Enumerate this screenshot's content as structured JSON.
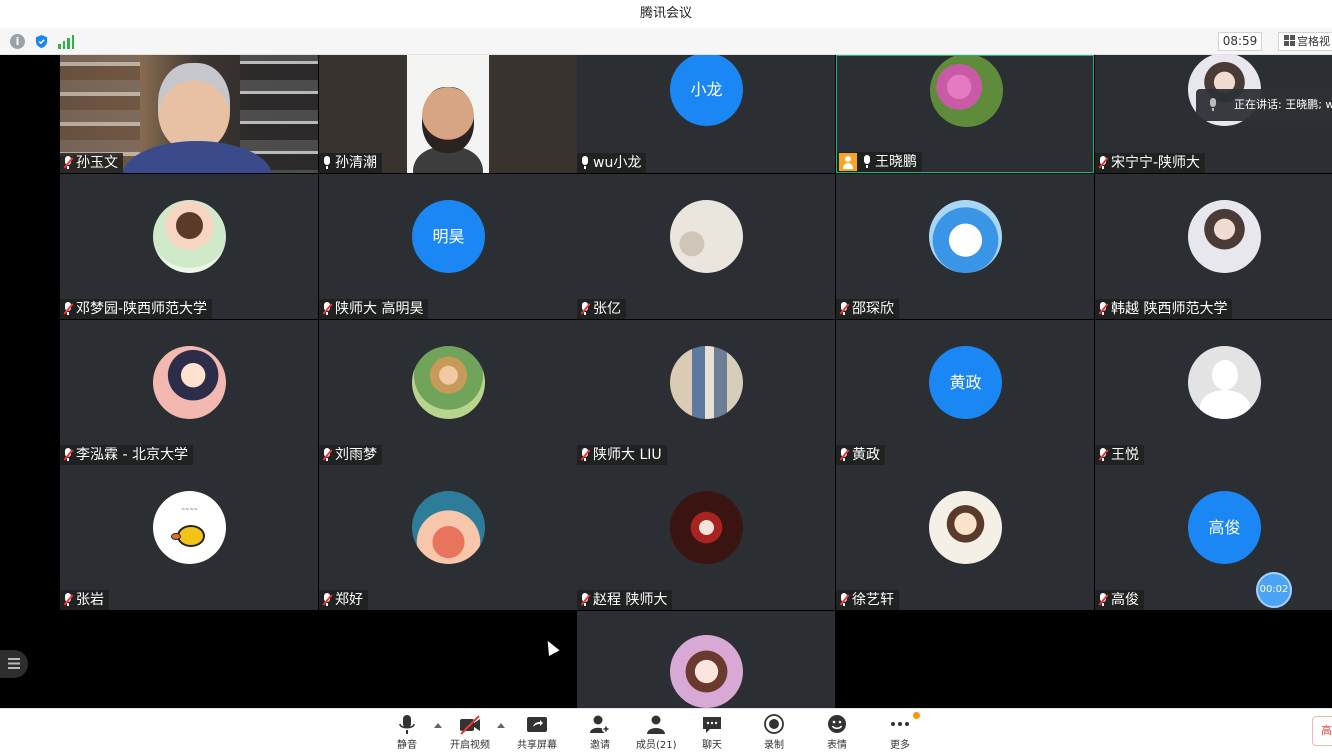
{
  "window": {
    "title": "腾讯会议"
  },
  "status": {
    "time": "08:59",
    "view_label": "宫格视",
    "info_icon": "info-icon",
    "security_icon": "shield-icon",
    "network_icon": "signal-icon"
  },
  "speaking": {
    "text": "正在讲话: 王晓鹏; w"
  },
  "timer": {
    "text": "00:02"
  },
  "participants": [
    {
      "name": "孙玉文",
      "muted": true,
      "kind": "video1"
    },
    {
      "name": "孙清潮",
      "muted": false,
      "kind": "video2"
    },
    {
      "name": "wu小龙",
      "muted": false,
      "kind": "text",
      "avatar_text": "小龙"
    },
    {
      "name": "王晓鹏",
      "muted": false,
      "kind": "pic",
      "pic": "av-flower",
      "host": true,
      "active": true
    },
    {
      "name": "宋宁宁-陕师大",
      "muted": true,
      "kind": "pic",
      "pic": "av-girl"
    },
    {
      "name": "邓梦园-陕西师范大学",
      "muted": true,
      "kind": "pic",
      "pic": "av-anime1"
    },
    {
      "name": "陕师大 高明昊",
      "muted": true,
      "kind": "text",
      "avatar_text": "明昊"
    },
    {
      "name": "张亿",
      "muted": true,
      "kind": "pic",
      "pic": "av-bag"
    },
    {
      "name": "邵琛欣",
      "muted": true,
      "kind": "pic",
      "pic": "av-dora"
    },
    {
      "name": "韩越 陕西师范大学",
      "muted": true,
      "kind": "pic",
      "pic": "av-girl"
    },
    {
      "name": "李泓霖 - 北京大学",
      "muted": true,
      "kind": "pic",
      "pic": "av-anime2"
    },
    {
      "name": "刘雨梦",
      "muted": true,
      "kind": "pic",
      "pic": "av-woman"
    },
    {
      "name": "陕师大 LIU",
      "muted": true,
      "kind": "pic",
      "pic": "av-gallery"
    },
    {
      "name": "黄政",
      "muted": true,
      "kind": "text",
      "avatar_text": "黄政"
    },
    {
      "name": "王悦",
      "muted": true,
      "kind": "pic",
      "pic": "av-gray"
    },
    {
      "name": "张岩",
      "muted": true,
      "kind": "pic",
      "pic": "av-duck"
    },
    {
      "name": "郑好",
      "muted": true,
      "kind": "pic",
      "pic": "av-bunny"
    },
    {
      "name": "赵程 陕师大",
      "muted": true,
      "kind": "pic",
      "pic": "av-dancer"
    },
    {
      "name": "徐艺轩",
      "muted": true,
      "kind": "pic",
      "pic": "av-cartoon"
    },
    {
      "name": "高俊",
      "muted": true,
      "kind": "text",
      "avatar_text": "高俊"
    },
    {
      "name": "",
      "muted": false,
      "kind": "pic",
      "pic": "av-princess"
    }
  ],
  "toolbar": {
    "mute": "静音",
    "video": "开启视频",
    "share": "共享屏幕",
    "invite": "邀请",
    "members": "成员(21)",
    "chat": "聊天",
    "record": "录制",
    "emoji": "表情",
    "more": "更多",
    "right_btn": "高"
  },
  "colors": {
    "accent": "#1a87f5",
    "tile_bg": "#2b2f33",
    "active_border": "#1fb575",
    "host_badge": "#f6a623",
    "mute_red": "#e53935"
  }
}
